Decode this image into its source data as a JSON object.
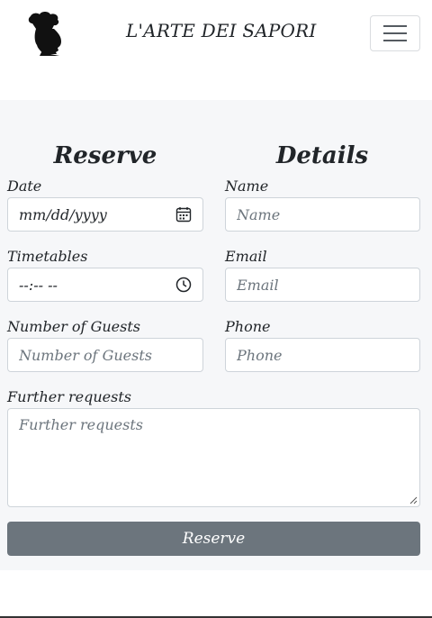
{
  "navbar": {
    "brand": "L'ARTE DEI SAPORI",
    "logo_icon": "chef-head-logo",
    "toggler_icon": "hamburger-icon"
  },
  "form": {
    "left_heading": "Reserve",
    "right_heading": "Details",
    "date": {
      "label": "Date",
      "value": "mm/dd/yyyy",
      "icon": "calendar-icon"
    },
    "time": {
      "label": "Timetables",
      "value": "--:-- --",
      "icon": "clock-icon"
    },
    "guests": {
      "label": "Number of Guests",
      "placeholder": "Number of Guests"
    },
    "name": {
      "label": "Name",
      "placeholder": "Name"
    },
    "email": {
      "label": "Email",
      "placeholder": "Email"
    },
    "phone": {
      "label": "Phone",
      "placeholder": "Phone"
    },
    "requests": {
      "label": "Further requests",
      "placeholder": "Further requests"
    },
    "submit_label": "Reserve"
  },
  "colors": {
    "section_bg": "#f6f7f9",
    "button_bg": "#6c757d",
    "border": "#ced4da"
  }
}
